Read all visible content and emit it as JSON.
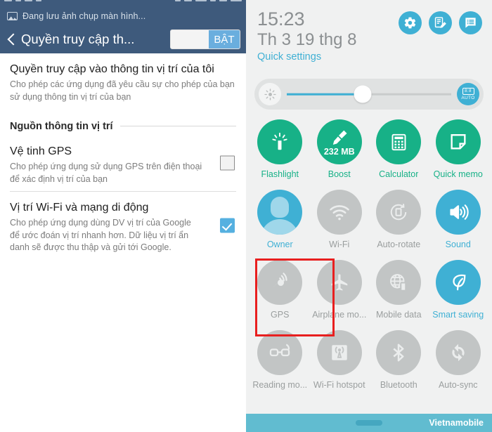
{
  "left": {
    "notification": {
      "icon": "image-icon",
      "text": "Đang lưu ảnh chụp màn hình..."
    },
    "titlebar": {
      "back_icon": "back-chevron-icon",
      "title": "Quyền truy cập th...",
      "switch_label": "BẬT",
      "switch_state": "on"
    },
    "rows": [
      {
        "title": "Quyền truy cập vào thông tin vị trí của tôi",
        "desc": "Cho phép các ứng dụng đã yêu cầu sự cho phép của bạn sử dụng thông tin vị trí của bạn",
        "control": "none"
      },
      {
        "title": "Vệ tinh GPS",
        "desc": "Cho phép ứng dụng sử dụng GPS trên điện thoại để xác định vị trí của bạn",
        "control": "checkbox-off"
      },
      {
        "title": "Vị trí Wi-Fi và mạng di động",
        "desc": "Cho phép ứng dụng dùng DV vị trí của Google để ước đoán vị trí nhanh hơn. Dữ liệu vị trí ẩn danh sẽ được thu thập và gửi tới Google.",
        "control": "checkbox-on"
      }
    ],
    "section_header": "Nguồn thông tin vị trí"
  },
  "right": {
    "header": {
      "time": "15:23",
      "date": "Th 3 19 thg 8",
      "quick_settings_label": "Quick settings",
      "icons": [
        "gear-icon",
        "edit-list-icon",
        "notification-list-icon"
      ]
    },
    "brightness": {
      "left_icon": "brightness-low-icon",
      "auto_icon": "auto-brightness-icon",
      "auto_label": "AUTO",
      "value_percent": 46
    },
    "tiles": [
      {
        "label": "Flashlight",
        "icon": "flashlight-icon",
        "state": "on",
        "color": "#17b187"
      },
      {
        "label": "Boost",
        "icon": "broom-icon",
        "state": "on",
        "color": "#17b187",
        "badge": "232 MB"
      },
      {
        "label": "Calculator",
        "icon": "calculator-icon",
        "state": "on",
        "color": "#17b187"
      },
      {
        "label": "Quick memo",
        "icon": "memo-icon",
        "state": "on",
        "color": "#17b187"
      },
      {
        "label": "Owner",
        "icon": "avatar-icon",
        "state": "on",
        "color": "#3fb0d4"
      },
      {
        "label": "Wi-Fi",
        "icon": "wifi-icon",
        "state": "off",
        "color": "#c2c5c5"
      },
      {
        "label": "Auto-rotate",
        "icon": "auto-rotate-icon",
        "state": "off",
        "color": "#c2c5c5"
      },
      {
        "label": "Sound",
        "icon": "sound-icon",
        "state": "on",
        "color": "#3fb0d4"
      },
      {
        "label": "GPS",
        "icon": "gps-icon",
        "state": "off",
        "color": "#c2c5c5",
        "highlighted": true
      },
      {
        "label": "Airplane mo...",
        "icon": "airplane-icon",
        "state": "off",
        "color": "#c2c5c5"
      },
      {
        "label": "Mobile data",
        "icon": "mobile-data-icon",
        "state": "off",
        "color": "#c2c5c5"
      },
      {
        "label": "Smart saving",
        "icon": "leaf-icon",
        "state": "on",
        "color": "#3fb0d4"
      },
      {
        "label": "Reading mo...",
        "icon": "glasses-icon",
        "state": "off",
        "color": "#c2c5c5"
      },
      {
        "label": "Wi-Fi hotspot",
        "icon": "hotspot-icon",
        "state": "off",
        "color": "#c2c5c5"
      },
      {
        "label": "Bluetooth",
        "icon": "bluetooth-icon",
        "state": "off",
        "color": "#c2c5c5"
      },
      {
        "label": "Auto-sync",
        "icon": "sync-icon",
        "state": "off",
        "color": "#c2c5c5"
      }
    ],
    "bottom_bar": {
      "carrier": "Vietnamobile"
    }
  },
  "colors": {
    "header_navy": "#3e5a7c",
    "accent_blue": "#3fb0d4",
    "accent_green": "#17b187",
    "inactive_gray": "#c2c5c5",
    "highlight_red": "#e81f1f",
    "bottom_teal": "#61bcd0"
  }
}
